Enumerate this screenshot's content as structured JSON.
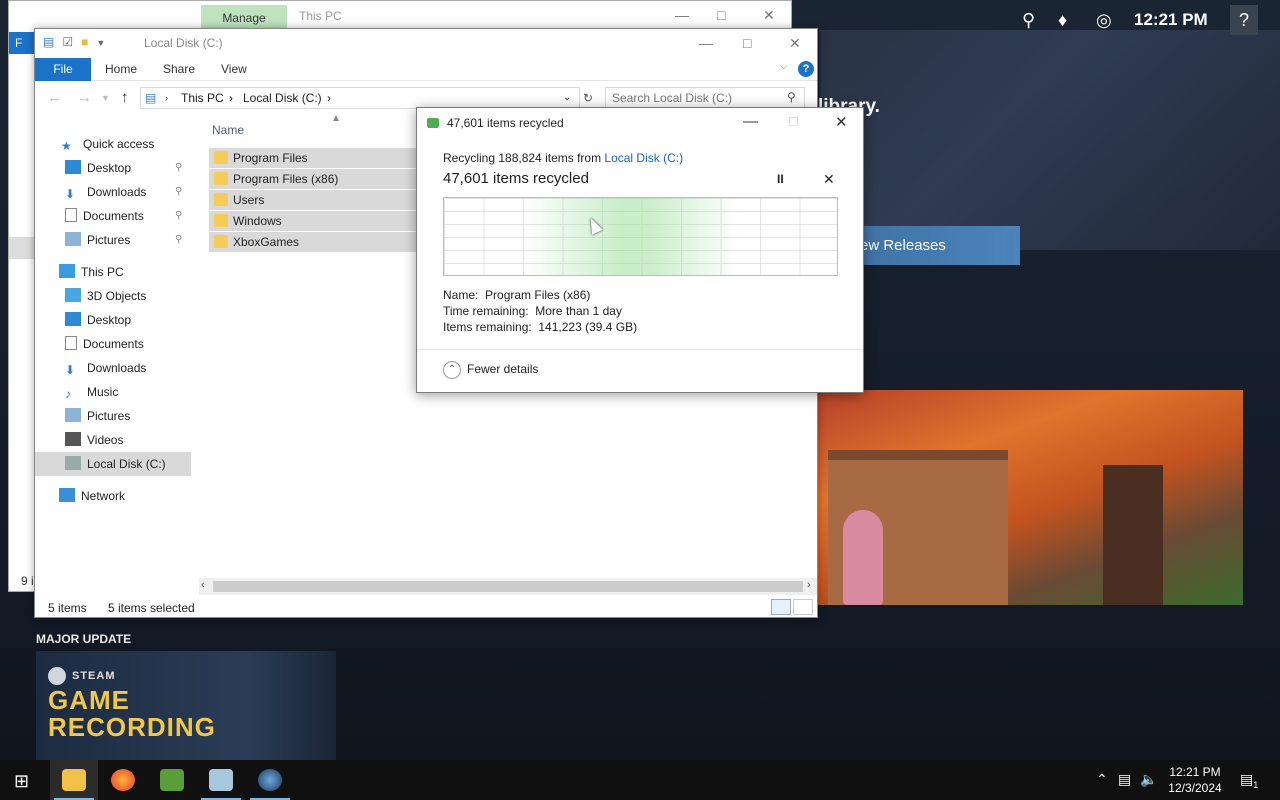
{
  "steam": {
    "time": "12:21 PM",
    "help_label": "?",
    "library_text": "library.",
    "new_releases_label": "ew Releases",
    "major_update_label": "MAJOR UPDATE",
    "steam_label": "STEAM",
    "game_recording_line1": "GAME",
    "game_recording_line2": "RECORDING",
    "icons": [
      "search-icon",
      "bell-icon",
      "globe-icon"
    ]
  },
  "back_window": {
    "manage_tab": "Manage",
    "title": "This PC",
    "file_tab": "F",
    "status_text": "9 i"
  },
  "explorer": {
    "title": "Local Disk (C:)",
    "ribbon_tabs": [
      "File",
      "Home",
      "Share",
      "View"
    ],
    "help_label": "?",
    "address": {
      "segment1": "This PC",
      "segment2": "Local Disk (C:)"
    },
    "search_placeholder": "Search Local Disk (C:)",
    "column_name": "Name",
    "nav": {
      "quick_access": "Quick access",
      "quick_items": [
        "Desktop",
        "Downloads",
        "Documents",
        "Pictures"
      ],
      "this_pc": "This PC",
      "pc_items": [
        "3D Objects",
        "Desktop",
        "Documents",
        "Downloads",
        "Music",
        "Pictures",
        "Videos",
        "Local Disk (C:)"
      ],
      "network": "Network"
    },
    "files": [
      "Program Files",
      "Program Files (x86)",
      "Users",
      "Windows",
      "XboxGames"
    ],
    "status_items": "5 items",
    "status_selected": "5 items selected"
  },
  "dialog": {
    "title": "47,601 items recycled",
    "recycling_prefix": "Recycling 188,824 items from ",
    "recycling_source": "Local Disk (C:)",
    "items_recycled": "47,601 items recycled",
    "name_label": "Name:",
    "name_value": "Program Files (x86)",
    "time_label": "Time remaining:",
    "time_value": "More than 1 day",
    "items_label": "Items remaining:",
    "items_value": "141,223 (39.4 GB)",
    "fewer_details": "Fewer details",
    "pause_glyph": "II",
    "cancel_glyph": "✕"
  },
  "taskbar": {
    "apps": [
      "file-explorer",
      "firefox",
      "minecraft",
      "remote-desktop",
      "steam"
    ],
    "clock_time": "12:21 PM",
    "clock_date": "12/3/2024",
    "notification_count": "1"
  }
}
